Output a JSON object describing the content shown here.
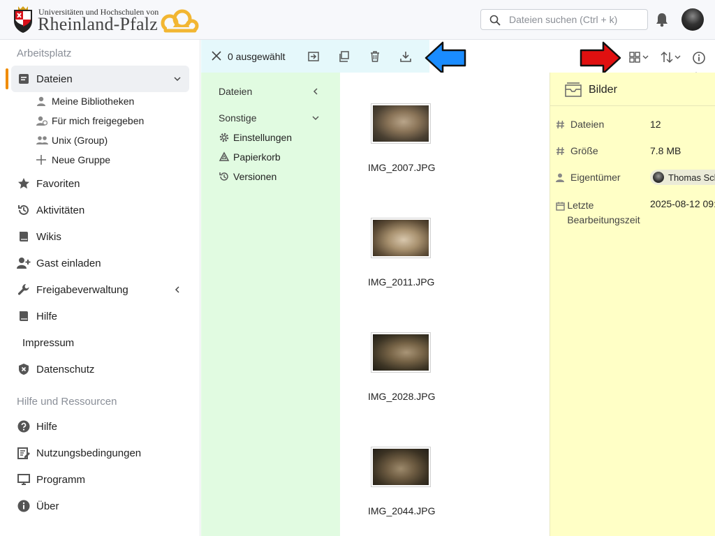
{
  "brand": {
    "line1": "Universitäten und Hochschulen von",
    "line2": "Rheinland-Pfalz"
  },
  "search": {
    "placeholder": "Dateien suchen (Ctrl + k)"
  },
  "sidebar": {
    "section1": "Arbeitsplatz",
    "items": [
      {
        "label": "Dateien",
        "icon": "files-icon"
      },
      {
        "label": "Favoriten",
        "icon": "star-icon"
      },
      {
        "label": "Aktivitäten",
        "icon": "history-icon"
      },
      {
        "label": "Wikis",
        "icon": "book-icon"
      },
      {
        "label": "Gast einladen",
        "icon": "add-user-icon"
      },
      {
        "label": "Freigabeverwaltung",
        "icon": "wrench-icon"
      },
      {
        "label": "Hilfe",
        "icon": "book-icon"
      },
      {
        "label": "Impressum",
        "icon": ""
      },
      {
        "label": "Datenschutz",
        "icon": "shield-icon"
      }
    ],
    "subitems": [
      {
        "label": "Meine Bibliotheken",
        "icon": "person-icon"
      },
      {
        "label": "Für mich freigegeben",
        "icon": "person-shared-icon"
      },
      {
        "label": "Unix (Group)",
        "icon": "group-icon"
      },
      {
        "label": "Neue Gruppe",
        "icon": "plus-icon"
      }
    ],
    "section2": "Hilfe und Ressourcen",
    "resources": [
      {
        "label": "Hilfe",
        "icon": "help-circle-icon"
      },
      {
        "label": "Nutzungsbedingungen",
        "icon": "edit-doc-icon"
      },
      {
        "label": "Programm",
        "icon": "monitor-icon"
      },
      {
        "label": "Über",
        "icon": "info-icon"
      }
    ]
  },
  "toolbar": {
    "selected": "0 ausgewählt"
  },
  "folder_nav": {
    "files": "Dateien",
    "other": "Sonstige",
    "items": [
      {
        "label": "Einstellungen",
        "icon": "gear-icon"
      },
      {
        "label": "Papierkorb",
        "icon": "recycle-icon"
      },
      {
        "label": "Versionen",
        "icon": "history-icon"
      }
    ]
  },
  "files": [
    {
      "name": "IMG_2007.JPG"
    },
    {
      "name": "IMG_2011.JPG"
    },
    {
      "name": "IMG_2028.JPG"
    },
    {
      "name": "IMG_2044.JPG"
    }
  ],
  "details": {
    "title": "Bilder",
    "rows": [
      {
        "key": "Dateien",
        "value": "12"
      },
      {
        "key": "Größe",
        "value": "7.8 MB"
      },
      {
        "key": "Eigentümer",
        "value": "Thomas Sch"
      },
      {
        "key": "Letzte Bearbeitungszeit",
        "value": "2025-08-12 09:"
      }
    ]
  },
  "colors": {
    "accent": "#f08c00",
    "toolbar_bg": "#e5f8fb",
    "nav_bg": "#e1fbe1",
    "details_bg": "#ffffc6",
    "arrow_blue": "#1a8cff",
    "arrow_red": "#e01010",
    "arrow_yellow": "#f0f020"
  }
}
